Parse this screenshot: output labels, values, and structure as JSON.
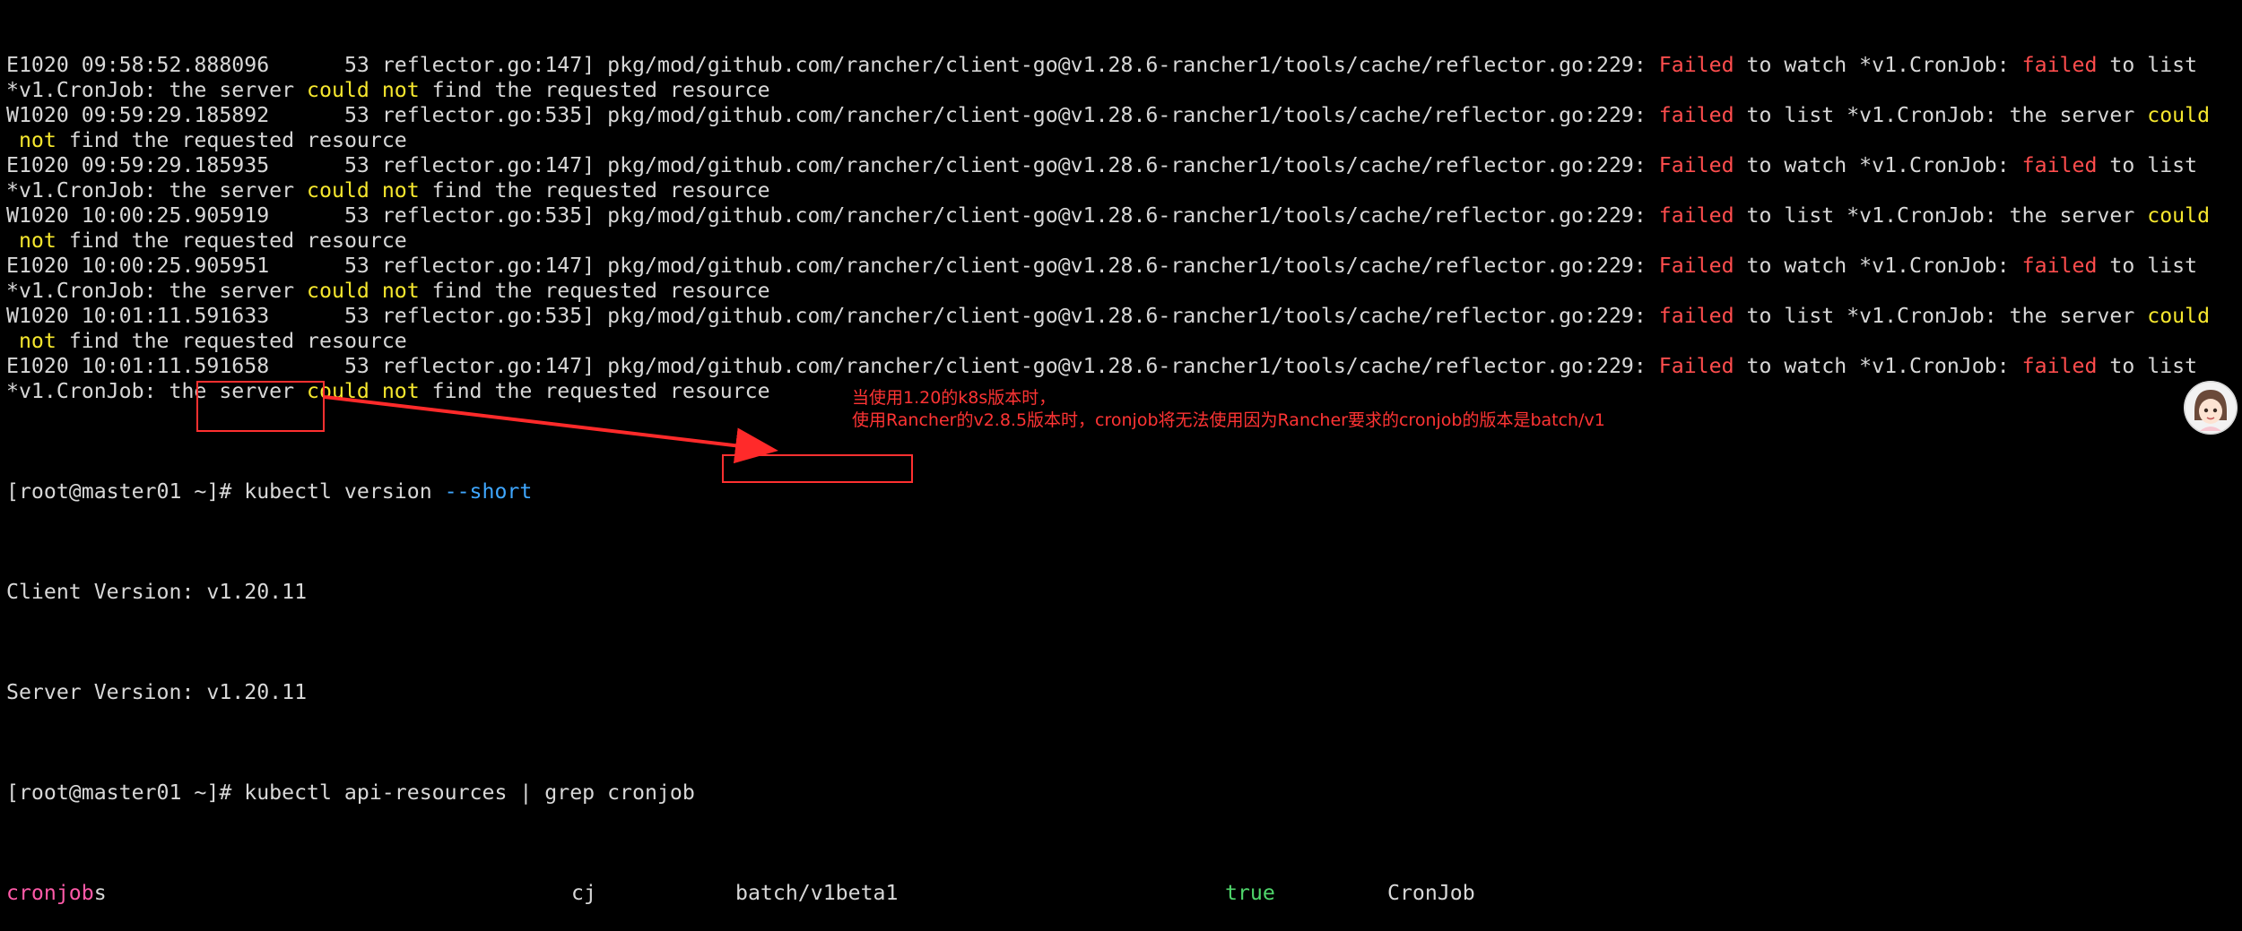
{
  "terminal": {
    "log_lines": [
      {
        "level": "E1020",
        "time": "09:58:52.888096",
        "pid": "53",
        "source": "reflector.go:147]",
        "path": "pkg/mod/github.com/rancher/client-go@v1.28.6-rancher1/tools/cache/reflector.go:229:",
        "msg1": "Failed",
        "msg2": " to watch *v1.CronJob: ",
        "msg3": "failed",
        "msg4": " to list"
      },
      {
        "cont1": "*v1.CronJob: the server ",
        "could": "could",
        "not": "not",
        "cont2": " find the requested resource"
      },
      {
        "level": "W1020",
        "time": "09:59:29.185892",
        "pid": "53",
        "source": "reflector.go:535]",
        "path": "pkg/mod/github.com/rancher/client-go@v1.28.6-rancher1/tools/cache/reflector.go:229:",
        "msg1": "failed",
        "msg2": " to list *v1.CronJob: the server ",
        "could": "could"
      },
      {
        "lead": " ",
        "not": "not",
        "cont2": " find the requested resource"
      },
      {
        "level": "E1020",
        "time": "09:59:29.185935",
        "pid": "53",
        "source": "reflector.go:147]",
        "path": "pkg/mod/github.com/rancher/client-go@v1.28.6-rancher1/tools/cache/reflector.go:229:",
        "msg1": "Failed",
        "msg2": " to watch *v1.CronJob: ",
        "msg3": "failed",
        "msg4": " to list"
      },
      {
        "cont1": "*v1.CronJob: the server ",
        "could": "could",
        "not": "not",
        "cont2": " find the requested resource"
      },
      {
        "level": "W1020",
        "time": "10:00:25.905919",
        "pid": "53",
        "source": "reflector.go:535]",
        "path": "pkg/mod/github.com/rancher/client-go@v1.28.6-rancher1/tools/cache/reflector.go:229:",
        "msg1": "failed",
        "msg2": " to list *v1.CronJob: the server ",
        "could": "could"
      },
      {
        "lead": " ",
        "not": "not",
        "cont2": " find the requested resource"
      },
      {
        "level": "E1020",
        "time": "10:00:25.905951",
        "pid": "53",
        "source": "reflector.go:147]",
        "path": "pkg/mod/github.com/rancher/client-go@v1.28.6-rancher1/tools/cache/reflector.go:229:",
        "msg1": "Failed",
        "msg2": " to watch *v1.CronJob: ",
        "msg3": "failed",
        "msg4": " to list"
      },
      {
        "cont1": "*v1.CronJob: the server ",
        "could": "could",
        "not": "not",
        "cont2": " find the requested resource"
      },
      {
        "level": "W1020",
        "time": "10:01:11.591633",
        "pid": "53",
        "source": "reflector.go:535]",
        "path": "pkg/mod/github.com/rancher/client-go@v1.28.6-rancher1/tools/cache/reflector.go:229:",
        "msg1": "failed",
        "msg2": " to list *v1.CronJob: the server ",
        "could": "could"
      },
      {
        "lead": " ",
        "not": "not",
        "cont2": " find the requested resource"
      },
      {
        "level": "E1020",
        "time": "10:01:11.591658",
        "pid": "53",
        "source": "reflector.go:147]",
        "path": "pkg/mod/github.com/rancher/client-go@v1.28.6-rancher1/tools/cache/reflector.go:229:",
        "msg1": "Failed",
        "msg2": " to watch *v1.CronJob: ",
        "msg3": "failed",
        "msg4": " to list"
      },
      {
        "cont1": "*v1.CronJob: the server ",
        "could": "could",
        "not": "not",
        "cont2": " find the requested resource"
      }
    ],
    "prompt1": "[root@master01 ~]# ",
    "cmd1": "kubectl version ",
    "cmd1_flag": "--short",
    "client_label": "Client Version: ",
    "client_value": "v1.20.11",
    "server_label": "Server Version: ",
    "server_value": "v1.20.11",
    "prompt2": "[root@master01 ~]# ",
    "cmd2": "kubectl api-resources | grep cronjob",
    "result": {
      "name_match": "cronjob",
      "name_rest": "s",
      "shortname": "cj",
      "apiversion": "batch/v1beta1",
      "namespaced": "true",
      "kind": "CronJob"
    }
  },
  "annotation": {
    "line1": "当使用1.20的k8s版本时，",
    "line2": "使用Rancher的v2.8.5版本时，cronjob将无法使用因为Rancher要求的cronjob的版本是batch/v1"
  },
  "colors": {
    "background": "#000000",
    "text": "#d8d8d8",
    "error": "#ff4d4d",
    "highlight": "#f6e72e",
    "flag": "#3fa7ff",
    "grep_match": "#ff5aa8",
    "true_value": "#4fd66b",
    "annotation": "#ff3434"
  },
  "icons": {
    "avatar": "assistant-avatar-icon"
  }
}
